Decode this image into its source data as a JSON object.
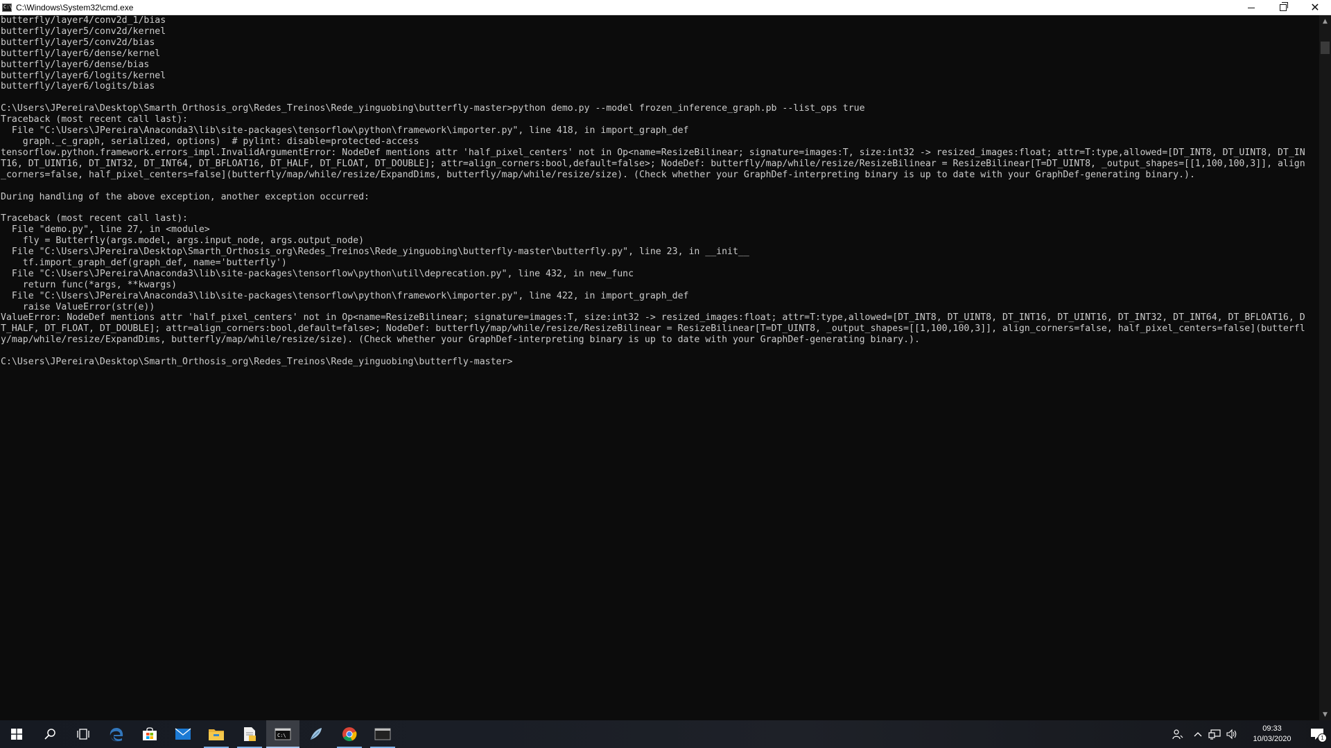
{
  "window": {
    "title": "C:\\Windows\\System32\\cmd.exe",
    "icon_text": "C:\\",
    "controls": {
      "minimize": "minimize",
      "restore": "restore",
      "close": "close"
    }
  },
  "console": {
    "lines": [
      "butterfly/layer4/conv2d_1/bias",
      "butterfly/layer5/conv2d/kernel",
      "butterfly/layer5/conv2d/bias",
      "butterfly/layer6/dense/kernel",
      "butterfly/layer6/dense/bias",
      "butterfly/layer6/logits/kernel",
      "butterfly/layer6/logits/bias",
      "",
      "C:\\Users\\JPereira\\Desktop\\Smarth_Orthosis_org\\Redes_Treinos\\Rede_yinguobing\\butterfly-master>python demo.py --model frozen_inference_graph.pb --list_ops true",
      "Traceback (most recent call last):",
      "  File \"C:\\Users\\JPereira\\Anaconda3\\lib\\site-packages\\tensorflow\\python\\framework\\importer.py\", line 418, in import_graph_def",
      "    graph._c_graph, serialized, options)  # pylint: disable=protected-access",
      "tensorflow.python.framework.errors_impl.InvalidArgumentError: NodeDef mentions attr 'half_pixel_centers' not in Op<name=ResizeBilinear; signature=images:T, size:int32 -> resized_images:float; attr=T:type,allowed=[DT_INT8, DT_UINT8, DT_IN",
      "T16, DT_UINT16, DT_INT32, DT_INT64, DT_BFLOAT16, DT_HALF, DT_FLOAT, DT_DOUBLE]; attr=align_corners:bool,default=false>; NodeDef: butterfly/map/while/resize/ResizeBilinear = ResizeBilinear[T=DT_UINT8, _output_shapes=[[1,100,100,3]], align",
      "_corners=false, half_pixel_centers=false](butterfly/map/while/resize/ExpandDims, butterfly/map/while/resize/size). (Check whether your GraphDef-interpreting binary is up to date with your GraphDef-generating binary.).",
      "",
      "During handling of the above exception, another exception occurred:",
      "",
      "Traceback (most recent call last):",
      "  File \"demo.py\", line 27, in <module>",
      "    fly = Butterfly(args.model, args.input_node, args.output_node)",
      "  File \"C:\\Users\\JPereira\\Desktop\\Smarth_Orthosis_org\\Redes_Treinos\\Rede_yinguobing\\butterfly-master\\butterfly.py\", line 23, in __init__",
      "    tf.import_graph_def(graph_def, name='butterfly')",
      "  File \"C:\\Users\\JPereira\\Anaconda3\\lib\\site-packages\\tensorflow\\python\\util\\deprecation.py\", line 432, in new_func",
      "    return func(*args, **kwargs)",
      "  File \"C:\\Users\\JPereira\\Anaconda3\\lib\\site-packages\\tensorflow\\python\\framework\\importer.py\", line 422, in import_graph_def",
      "    raise ValueError(str(e))",
      "ValueError: NodeDef mentions attr 'half_pixel_centers' not in Op<name=ResizeBilinear; signature=images:T, size:int32 -> resized_images:float; attr=T:type,allowed=[DT_INT8, DT_UINT8, DT_INT16, DT_UINT16, DT_INT32, DT_INT64, DT_BFLOAT16, D",
      "T_HALF, DT_FLOAT, DT_DOUBLE]; attr=align_corners:bool,default=false>; NodeDef: butterfly/map/while/resize/ResizeBilinear = ResizeBilinear[T=DT_UINT8, _output_shapes=[[1,100,100,3]], align_corners=false, half_pixel_centers=false](butterfl",
      "y/map/while/resize/ExpandDims, butterfly/map/while/resize/size). (Check whether your GraphDef-interpreting binary is up to date with your GraphDef-generating binary.).",
      "",
      "C:\\Users\\JPereira\\Desktop\\Smarth_Orthosis_org\\Redes_Treinos\\Rede_yinguobing\\butterfly-master>"
    ]
  },
  "taskbar": {
    "apps": [
      {
        "name": "start-button",
        "icon": "windows-logo-icon"
      },
      {
        "name": "search-button",
        "icon": "search-icon"
      },
      {
        "name": "task-view-button",
        "icon": "task-view-icon"
      },
      {
        "name": "edge-button",
        "icon": "edge-icon"
      },
      {
        "name": "store-button",
        "icon": "store-icon"
      },
      {
        "name": "mail-button",
        "icon": "mail-icon"
      },
      {
        "name": "file-explorer-button",
        "icon": "folder-icon"
      },
      {
        "name": "notepad-button",
        "icon": "document-icon"
      },
      {
        "name": "cmd-button",
        "icon": "terminal-icon"
      },
      {
        "name": "app-button",
        "icon": "feather-icon"
      },
      {
        "name": "chrome-button",
        "icon": "chrome-icon"
      },
      {
        "name": "console-button",
        "icon": "console-window-icon"
      }
    ],
    "clock": {
      "time": "09:33",
      "date": "10/03/2020"
    },
    "notification_count": "1",
    "colors": {
      "accent": "#7fb3e8",
      "console_bg": "#0c0c0c",
      "console_text": "#cccccc"
    }
  }
}
